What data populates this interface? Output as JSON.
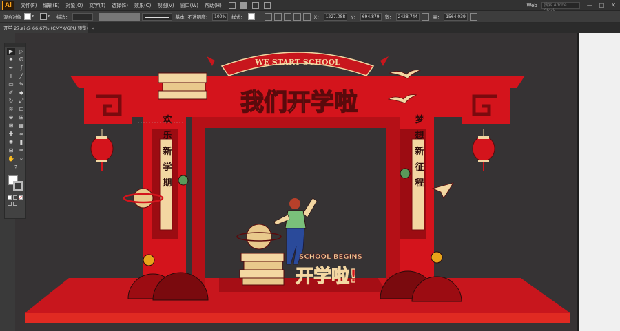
{
  "app": {
    "logo": "Ai",
    "menus": [
      "文件(F)",
      "编辑(E)",
      "对象(O)",
      "文字(T)",
      "选择(S)",
      "效果(C)",
      "视图(V)",
      "窗口(W)",
      "帮助(H)"
    ],
    "workspace": "Web",
    "search_placeholder": "搜索 Adobe Stock",
    "window_controls": [
      "—",
      "□",
      "✕"
    ]
  },
  "control_bar": {
    "selection_label": "混合对象",
    "stroke_label": "描边：",
    "stroke_profile": "基本",
    "opacity_label": "不透明度：",
    "opacity_value": "100%",
    "style_label": "样式：",
    "x_label": "X：",
    "x_value": "1227.088",
    "y_label": "Y：",
    "y_value": "694.879",
    "w_label": "宽：",
    "w_value": "2428.744",
    "h_label": "高：",
    "h_value": "1564.039"
  },
  "document_tab": {
    "title": "开学 27.ai @ 66.67% (CMYK/GPU 预览)",
    "close": "×"
  },
  "toolbar": {
    "tools": [
      "selection-tool",
      "direct-selection-tool",
      "magic-wand-tool",
      "lasso-tool",
      "pen-tool",
      "curvature-tool",
      "type-tool",
      "line-tool",
      "rectangle-tool",
      "paintbrush-tool",
      "shaper-tool",
      "eraser-tool",
      "rotate-tool",
      "scale-tool",
      "width-tool",
      "free-transform-tool",
      "shape-builder-tool",
      "perspective-tool",
      "mesh-tool",
      "gradient-tool",
      "eyedropper-tool",
      "blend-tool",
      "symbol-sprayer-tool",
      "column-graph-tool",
      "artboard-tool",
      "slice-tool",
      "hand-tool",
      "zoom-tool"
    ],
    "tool_glyphs": [
      "▶",
      "▷",
      "✦",
      "ʘ",
      "✒",
      "∫",
      "T",
      "╱",
      "▭",
      "✎",
      "✐",
      "◆",
      "↻",
      "⤢",
      "≋",
      "⊡",
      "⊕",
      "⊞",
      "⊠",
      "▦",
      "✚",
      "∞",
      "✺",
      "▮",
      "⊟",
      "✂",
      "✋",
      "⌕"
    ],
    "help_glyph": "?"
  },
  "artwork": {
    "banner_text": "WE START SCHOOL",
    "main_title": "我们开学啦",
    "left_couplet": "欢乐新学期",
    "right_couplet": "梦想新征程",
    "sign_small": "SCHOOL BEGINS",
    "sign_main": "开学啦!",
    "colors": {
      "red": "#d4141c",
      "dark_red": "#9c0c12",
      "cream": "#f3d7a2",
      "floor": "#c8161d",
      "bg": "#363334"
    }
  }
}
